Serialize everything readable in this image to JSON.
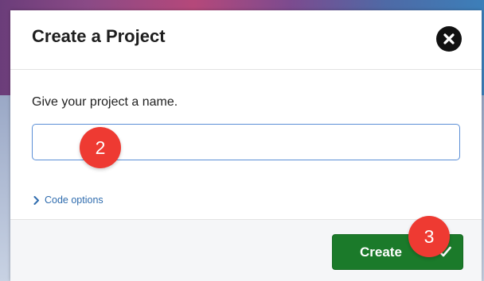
{
  "modal": {
    "title": "Create a Project",
    "close_icon": "close-x-icon"
  },
  "form": {
    "prompt": "Give your project a name.",
    "name_value": "",
    "code_options_label": "Code options",
    "code_options_icon": "chevron-right-icon"
  },
  "footer": {
    "create_label": "Create",
    "create_icon": "checkmark-icon"
  },
  "annotations": {
    "step2": "2",
    "step3": "3"
  },
  "colors": {
    "create_button": "#1b7a2a",
    "link": "#2f6cae",
    "badge": "#ee3a32",
    "input_border": "#5b8fd6"
  }
}
